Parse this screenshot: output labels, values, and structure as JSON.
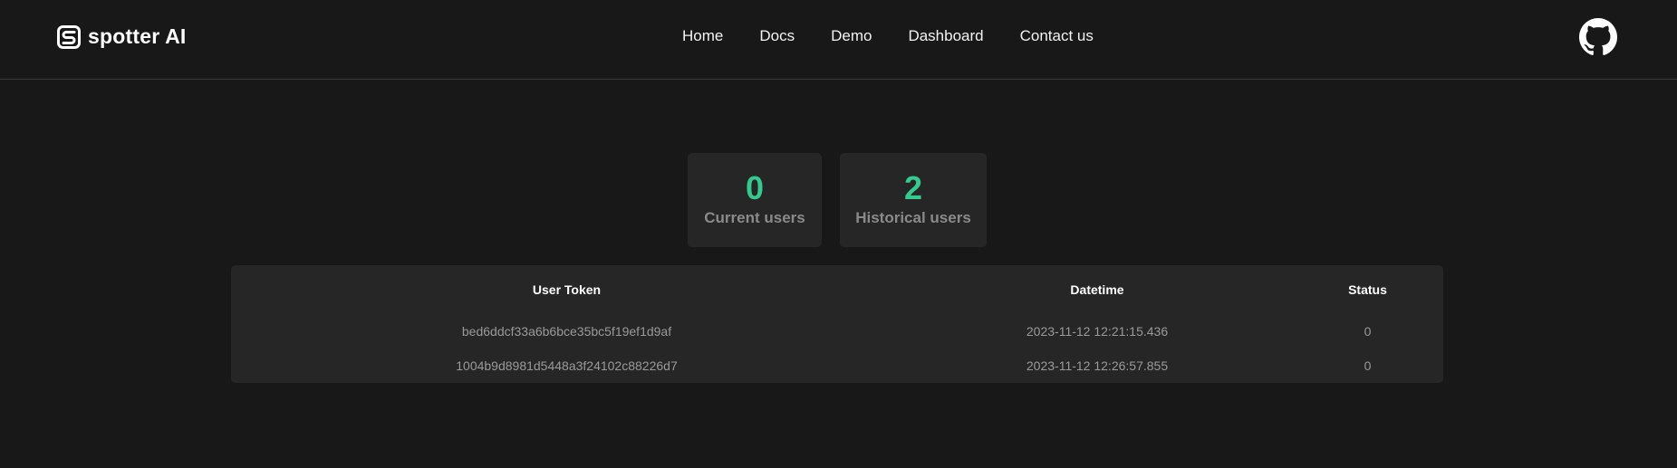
{
  "brand": {
    "name": "spotter AI",
    "logo_icon": "spotter-s-logo-icon"
  },
  "nav": {
    "items": [
      {
        "label": "Home"
      },
      {
        "label": "Docs"
      },
      {
        "label": "Demo"
      },
      {
        "label": "Dashboard"
      },
      {
        "label": "Contact us"
      }
    ]
  },
  "header": {
    "github_icon": "github-icon"
  },
  "stats": {
    "current": {
      "value": "0",
      "label": "Current users"
    },
    "historical": {
      "value": "2",
      "label": "Historical users"
    }
  },
  "table": {
    "headers": [
      "User Token",
      "Datetime",
      "Status"
    ],
    "rows": [
      [
        "bed6ddcf33a6b6bce35bc5f19ef1d9af",
        "2023-11-12 12:21:15.436",
        "0"
      ],
      [
        "1004b9d8981d5448a3f24102c88226d7",
        "2023-11-12 12:26:57.855",
        "0"
      ]
    ]
  },
  "colors": {
    "background": "#181818",
    "card": "#262626",
    "accent": "#34c98e",
    "muted_text": "#9a9a9a"
  }
}
